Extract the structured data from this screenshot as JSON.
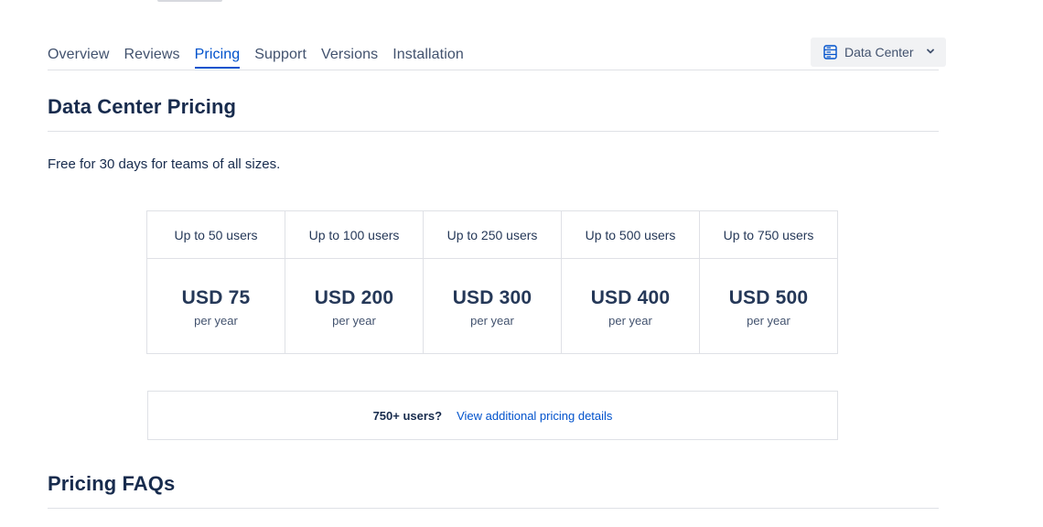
{
  "tabs": [
    {
      "label": "Overview"
    },
    {
      "label": "Reviews"
    },
    {
      "label": "Pricing"
    },
    {
      "label": "Support"
    },
    {
      "label": "Versions"
    },
    {
      "label": "Installation"
    }
  ],
  "active_tab": "Pricing",
  "hosting_selector": {
    "label": "Data Center",
    "icon": "server-icon"
  },
  "section_title": "Data Center Pricing",
  "trial_text": "Free for 30 days for teams of all sizes.",
  "tiers": [
    {
      "users": "Up to 50 users",
      "price": "USD 75",
      "period": "per year"
    },
    {
      "users": "Up to 100 users",
      "price": "USD 200",
      "period": "per year"
    },
    {
      "users": "Up to 250 users",
      "price": "USD 300",
      "period": "per year"
    },
    {
      "users": "Up to 500 users",
      "price": "USD 400",
      "period": "per year"
    },
    {
      "users": "Up to 750 users",
      "price": "USD 500",
      "period": "per year"
    }
  ],
  "additional": {
    "users_label": "750+ users?",
    "link_label": "View additional pricing details"
  },
  "faq_title": "Pricing FAQs",
  "colors": {
    "accent": "#0052cc",
    "text": "#172b4d",
    "border": "#dfe1e6",
    "select_bg": "#f1f2f4"
  }
}
